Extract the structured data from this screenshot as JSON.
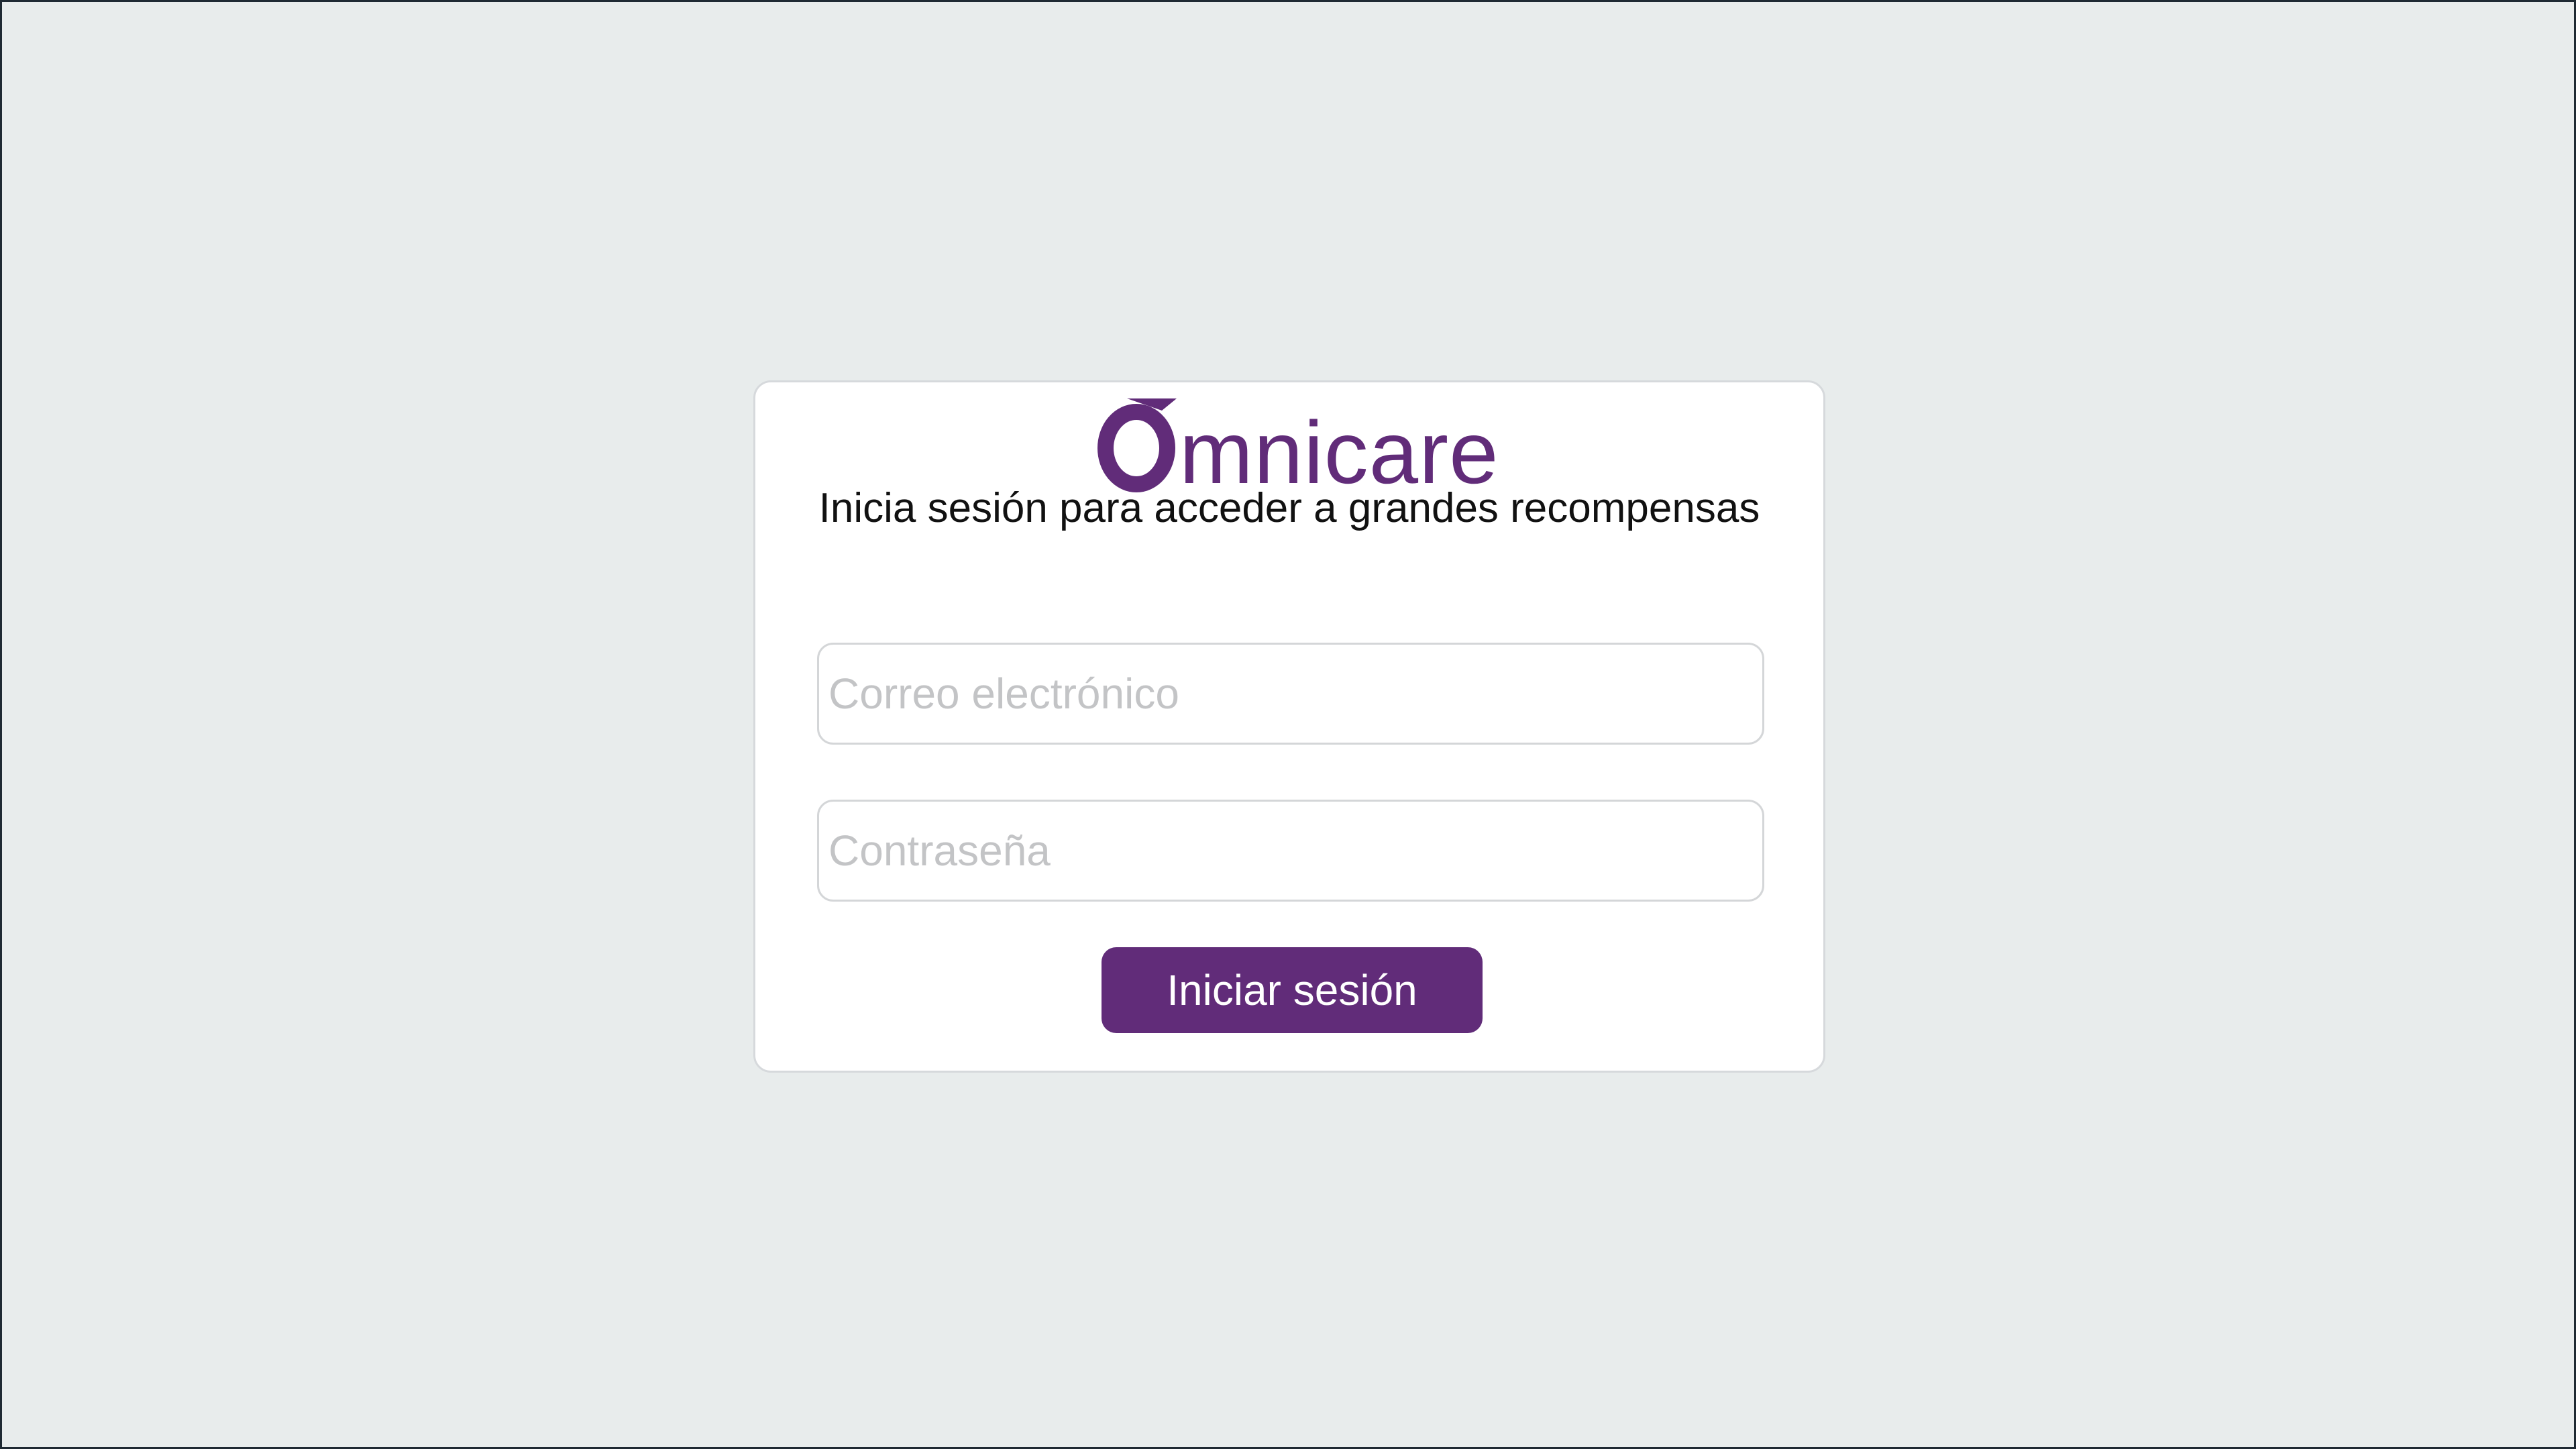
{
  "brand": {
    "name": "Omnicare",
    "logo_text": "mnicare",
    "logo_icon": "omnicare-o-mark",
    "color": "#612c79"
  },
  "login": {
    "tagline": "Inicia sesión para acceder a grandes recompensas",
    "email": {
      "placeholder": "Correo electrónico",
      "value": ""
    },
    "password": {
      "placeholder": "Contraseña",
      "value": ""
    },
    "submit_label": "Iniciar sesión"
  },
  "colors": {
    "background": "#e8ecec",
    "card": "#ffffff",
    "accent": "#612c79",
    "placeholder": "#c3c4c6"
  }
}
